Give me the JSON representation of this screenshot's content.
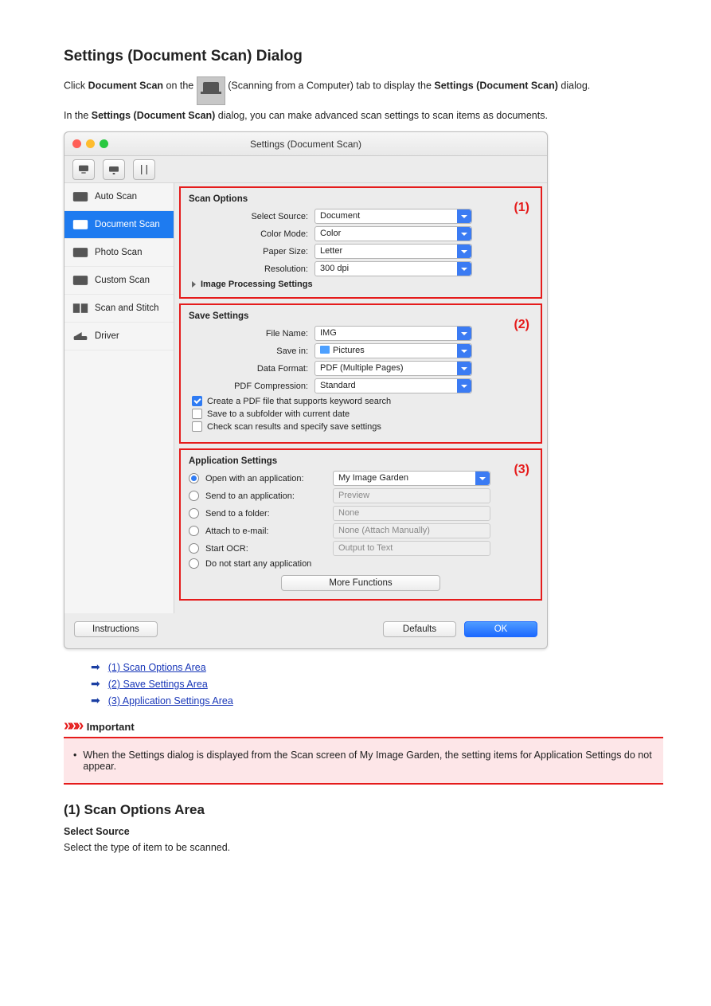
{
  "page": {
    "title": "Settings (Document Scan) Dialog",
    "intro_a": "Click ",
    "intro_b": "Document Scan",
    "intro_c": " on the ",
    "intro_d": " (Scanning from a Computer) tab to display the ",
    "intro_e": "Settings (Document Scan)",
    "intro_f": " dialog.",
    "desc_a": "In the ",
    "desc_b": "Settings (Document Scan)",
    "desc_c": " dialog, you can make advanced scan settings to scan items as documents."
  },
  "window": {
    "title": "Settings (Document Scan)"
  },
  "toolbar": {
    "btn1": "scanner-computer-icon",
    "btn2": "scanner-network-icon",
    "btn3": "tools-icon"
  },
  "sidebar": {
    "items": [
      "Auto Scan",
      "Document Scan",
      "Photo Scan",
      "Custom Scan",
      "Scan and Stitch",
      "Driver"
    ]
  },
  "section_markers": {
    "one": "(1)",
    "two": "(2)",
    "three": "(3)"
  },
  "scan_options": {
    "title": "Scan Options",
    "select_source_lbl": "Select Source:",
    "select_source_val": "Document",
    "color_mode_lbl": "Color Mode:",
    "color_mode_val": "Color",
    "paper_size_lbl": "Paper Size:",
    "paper_size_val": "Letter",
    "resolution_lbl": "Resolution:",
    "resolution_val": "300 dpi",
    "disclose": "Image Processing Settings"
  },
  "save_settings": {
    "title": "Save Settings",
    "filename_lbl": "File Name:",
    "filename_val": "IMG",
    "savein_lbl": "Save in:",
    "savein_val": "Pictures",
    "dataformat_lbl": "Data Format:",
    "dataformat_val": "PDF (Multiple Pages)",
    "pdfcomp_lbl": "PDF Compression:",
    "pdfcomp_val": "Standard",
    "chk_keyword": "Create a PDF file that supports keyword search",
    "chk_subfolder": "Save to a subfolder with current date",
    "chk_checkresults": "Check scan results and specify save settings"
  },
  "app_settings": {
    "title": "Application Settings",
    "open_app_lbl": "Open with an application:",
    "open_app_val": "My Image Garden",
    "send_app_lbl": "Send to an application:",
    "send_app_val": "Preview",
    "send_folder_lbl": "Send to a folder:",
    "send_folder_val": "None",
    "email_lbl": "Attach to e-mail:",
    "email_val": "None (Attach Manually)",
    "ocr_lbl": "Start OCR:",
    "ocr_val": "Output to Text",
    "none_lbl": "Do not start any application",
    "more_functions": "More Functions"
  },
  "buttons": {
    "instructions": "Instructions",
    "defaults": "Defaults",
    "ok": "OK"
  },
  "links": {
    "l1": "(1) Scan Options Area",
    "l2": "(2) Save Settings Area",
    "l3": "(3) Application Settings Area"
  },
  "important": {
    "heading": "Important",
    "text": "When the Settings dialog is displayed from the Scan screen of My Image Garden, the setting items for Application Settings do not appear."
  },
  "h2": "(1) Scan Options Area",
  "field_desc": {
    "label": "Select Source",
    "text": "Select the type of item to be scanned."
  }
}
